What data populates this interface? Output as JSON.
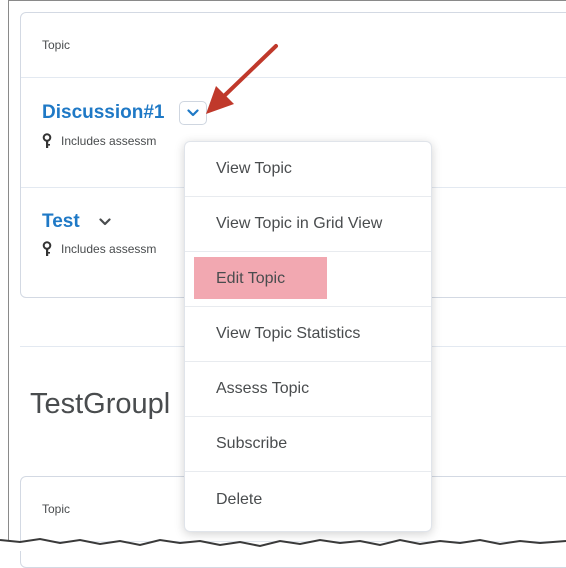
{
  "topics_table": {
    "header_label": "Topic",
    "rows": [
      {
        "title": "Discussion#1",
        "meta": "Includes assessm"
      },
      {
        "title": "Test",
        "meta": "Includes assessm"
      }
    ]
  },
  "group": {
    "title": "TestGroupl",
    "header_label": "Topic"
  },
  "context_menu": {
    "items": [
      "View Topic",
      "View Topic in Grid View",
      "Edit Topic",
      "View Topic Statistics",
      "Assess Topic",
      "Subscribe",
      "Delete"
    ],
    "highlighted_item": "Edit Topic"
  },
  "colors": {
    "link": "#1f79c6",
    "highlight": "#f2a8b1",
    "arrow": "#c0392b"
  },
  "icons": [
    "key-icon",
    "chevron-down-icon",
    "red-arrow-annotation"
  ]
}
